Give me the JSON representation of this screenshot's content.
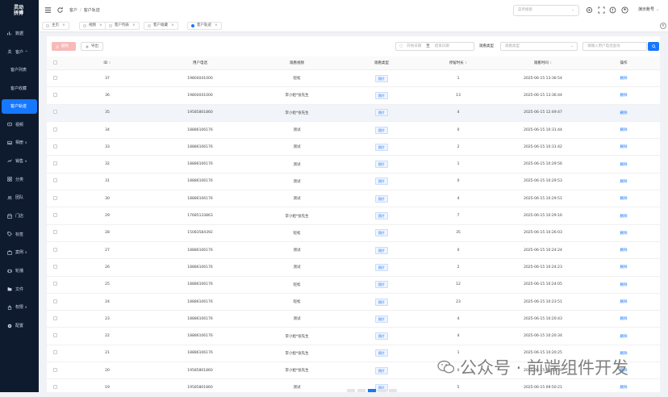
{
  "sidebar": {
    "logo_line1": "灵动",
    "logo_line2": "拼搏",
    "items": [
      {
        "label": "数据",
        "icon": "chart-icon"
      },
      {
        "label": "客户",
        "icon": "user-icon",
        "chevron": "^"
      },
      {
        "label": "客户列表",
        "sub": true
      },
      {
        "label": "客户收藏",
        "sub": true
      },
      {
        "label": "客户轨迹",
        "sub": true,
        "active": true
      },
      {
        "label": "视频",
        "icon": "video-icon"
      },
      {
        "label": "相册",
        "icon": "image-icon",
        "chevron": "v"
      },
      {
        "label": "销售",
        "icon": "sales-icon",
        "chevron": "v"
      },
      {
        "label": "分类",
        "icon": "category-icon"
      },
      {
        "label": "团队",
        "icon": "team-icon"
      },
      {
        "label": "门店",
        "icon": "store-icon"
      },
      {
        "label": "标签",
        "icon": "tag-icon"
      },
      {
        "label": "案例",
        "icon": "case-icon",
        "chevron": "v"
      },
      {
        "label": "轮播",
        "icon": "carousel-icon"
      },
      {
        "label": "文件",
        "icon": "folder-icon"
      },
      {
        "label": "权限",
        "icon": "lock-icon",
        "chevron": "v"
      },
      {
        "label": "配置",
        "icon": "settings-icon"
      }
    ]
  },
  "header": {
    "crumb_root": "客户",
    "crumb_sep": "/",
    "crumb_current": "客户轨迹",
    "search_placeholder": "菜单搜索",
    "user_name": "演示账号"
  },
  "tabs": [
    {
      "label": "主页"
    },
    {
      "label": "视频"
    },
    {
      "label": "客户列表"
    },
    {
      "label": "客户收藏"
    },
    {
      "label": "客户轨迹",
      "active": true
    }
  ],
  "toolbar": {
    "delete_label": "删除",
    "export_label": "导出",
    "date_start": "开始日期",
    "date_to": "至",
    "date_end": "结束日期",
    "type_label": "观看类型",
    "type_placeholder": "观看类型",
    "phone_placeholder": "请输入用户电话查询"
  },
  "table": {
    "headers": [
      "ID",
      "用户电话",
      "观看视频",
      "观看类型",
      "停留时长",
      "观看时间",
      "操作"
    ],
    "action_label": "删除",
    "rows": [
      [
        "37",
        "19804041000",
        "轻松",
        "照片",
        "1",
        "2025-06-15 13:36:54"
      ],
      [
        "36",
        "19804041000",
        "李小姐*张先生",
        "照片",
        "13",
        "2025-06-15 13:36:44"
      ],
      [
        "35",
        "19585801860",
        "李小姐*张先生",
        "照片",
        "4",
        "2025-06-15 12:49:47"
      ],
      [
        "34",
        "18886106176",
        "测试",
        "照片",
        "0",
        "2025-06-15 10:31:44"
      ],
      [
        "33",
        "18886106176",
        "测试",
        "照片",
        "2",
        "2025-06-15 10:31:42"
      ],
      [
        "32",
        "18886106176",
        "测试",
        "照片",
        "1",
        "2025-06-15 10:29:56"
      ],
      [
        "31",
        "18886106176",
        "测试",
        "照片",
        "0",
        "2025-06-15 10:29:53"
      ],
      [
        "30",
        "18886106176",
        "测试",
        "照片",
        "4",
        "2025-06-15 10:29:51"
      ],
      [
        "29",
        "17685133863",
        "李小姐*张先生",
        "照片",
        "7",
        "2025-06-15 10:29:16"
      ],
      [
        "28",
        "15083584392",
        "轻松",
        "照片",
        "35",
        "2025-06-15 10:26:03"
      ],
      [
        "27",
        "18886106176",
        "测试",
        "照片",
        "0",
        "2025-06-15 10:24:24"
      ],
      [
        "26",
        "18886106176",
        "测试",
        "照片",
        "2",
        "2025-06-15 10:24:23"
      ],
      [
        "25",
        "18886106176",
        "轻松",
        "照片",
        "12",
        "2025-06-15 10:24:05"
      ],
      [
        "24",
        "18886106176",
        "轻松",
        "照片",
        "23",
        "2025-06-15 10:23:51"
      ],
      [
        "23",
        "18886106176",
        "测试",
        "照片",
        "4",
        "2025-06-15 10:20:43"
      ],
      [
        "22",
        "18886106176",
        "李小姐*张先生",
        "照片",
        "4",
        "2025-06-15 10:20:34"
      ],
      [
        "21",
        "18886106176",
        "李小姐*张先生",
        "照片",
        "1",
        "2025-06-15 10:20:25"
      ],
      [
        "20",
        "19585801860",
        "李小姐*张先生",
        "照片",
        "0",
        "2025-06-15 09:53:30"
      ],
      [
        "19",
        "19585801860",
        "测试",
        "照片",
        "5",
        "2025-06-15 09:50:21"
      ]
    ]
  },
  "watermark": {
    "text": "公众号 · 前端组件开发"
  },
  "colors": {
    "sidebar": "#0e1b2f",
    "accent": "#1677ff",
    "danger_light": "#f8b9b9"
  }
}
